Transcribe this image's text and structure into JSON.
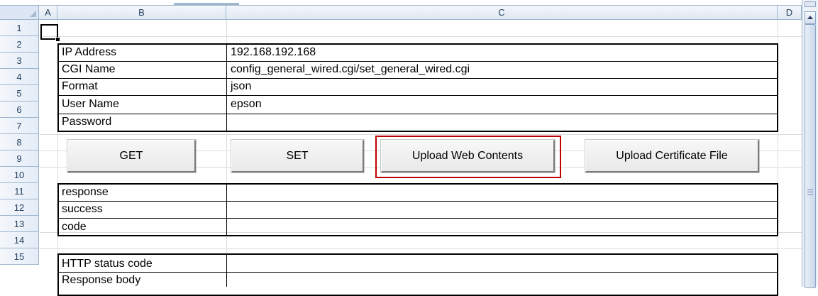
{
  "sheet": {
    "columns": [
      "A",
      "B",
      "C",
      "D"
    ],
    "rows": [
      "1",
      "2",
      "3",
      "4",
      "5",
      "6",
      "7",
      "8",
      "9",
      "10",
      "11",
      "12",
      "13",
      "14",
      "15"
    ]
  },
  "settings_table": [
    {
      "label": "IP Address",
      "value": "192.168.192.168"
    },
    {
      "label": "CGI Name",
      "value": "config_general_wired.cgi/set_general_wired.cgi"
    },
    {
      "label": "Format",
      "value": "json"
    },
    {
      "label": "User Name",
      "value": "epson"
    },
    {
      "label": "Password",
      "value": ""
    }
  ],
  "buttons": {
    "get": "GET",
    "set": "SET",
    "upload_web": "Upload Web Contents",
    "upload_cert": "Upload Certificate File"
  },
  "response_table": [
    {
      "label": "response",
      "value": ""
    },
    {
      "label": "success",
      "value": ""
    },
    {
      "label": "code",
      "value": ""
    }
  ],
  "http_table": [
    {
      "label": "HTTP status code",
      "value": ""
    },
    {
      "label": "Response body",
      "value": ""
    }
  ],
  "colors": {
    "highlight_border": "#c00000",
    "header_bg": "#dce6f4"
  }
}
